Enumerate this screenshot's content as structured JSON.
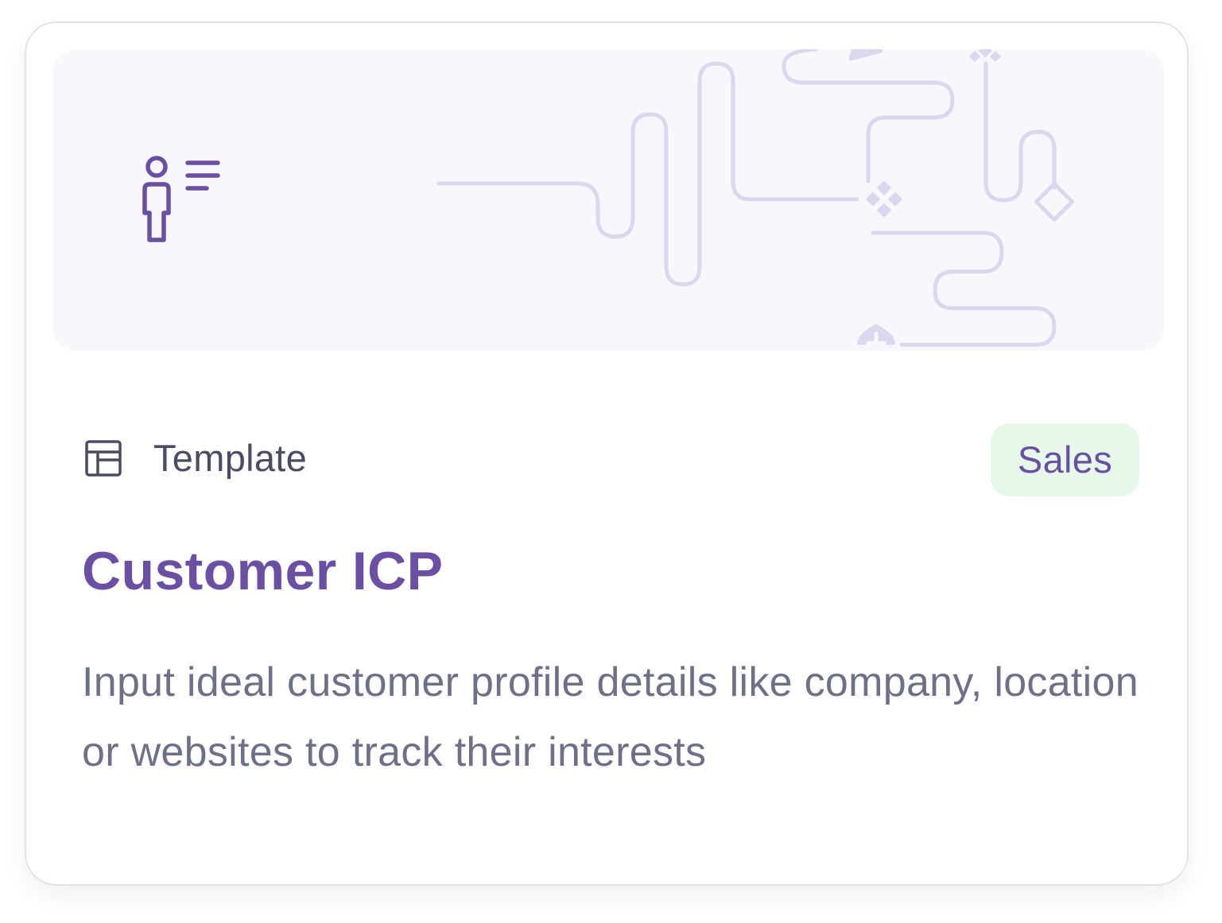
{
  "card": {
    "type_label": "Template",
    "tag": "Sales",
    "title": "Customer ICP",
    "description": "Input ideal customer profile details like company, location or websites to track their interests"
  },
  "icons": {
    "banner": "person-profile-list-icon",
    "type": "layout-template-icon"
  },
  "colors": {
    "accent": "#6a4fa3",
    "tag_background": "#e5f8ea",
    "banner_background": "#f8f7fd",
    "banner_lines": "#dcd7ee",
    "type_text": "#4a4c63",
    "description_text": "#6d7088",
    "border": "#e3e3e6"
  }
}
